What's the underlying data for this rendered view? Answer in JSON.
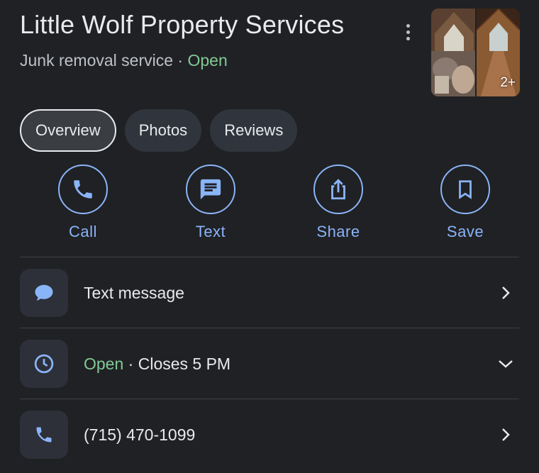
{
  "place": {
    "title": "Little Wolf Property Services",
    "category": "Junk removal service",
    "separator": "·",
    "status": "Open"
  },
  "thumbnail": {
    "badge": "2+"
  },
  "tabs": [
    {
      "label": "Overview",
      "active": true
    },
    {
      "label": "Photos",
      "active": false
    },
    {
      "label": "Reviews",
      "active": false
    }
  ],
  "actions": [
    {
      "label": "Call",
      "icon": "phone-icon"
    },
    {
      "label": "Text",
      "icon": "message-icon"
    },
    {
      "label": "Share",
      "icon": "share-icon"
    },
    {
      "label": "Save",
      "icon": "bookmark-icon"
    }
  ],
  "rows": {
    "message": {
      "label": "Text message",
      "icon": "chat-bubble-icon",
      "trail": "chevron-right-icon"
    },
    "hours": {
      "status": "Open",
      "separator": "·",
      "detail": "Closes 5 PM",
      "icon": "clock-icon",
      "trail": "chevron-down-icon"
    },
    "phone": {
      "label": "(715) 470-1099",
      "icon": "phone-icon",
      "trail": "chevron-right-icon"
    }
  },
  "colors": {
    "background": "#202124",
    "accent": "#8ab4f8",
    "open": "#81c995",
    "text": "#e8eaed",
    "muted": "#bdc1c6"
  }
}
